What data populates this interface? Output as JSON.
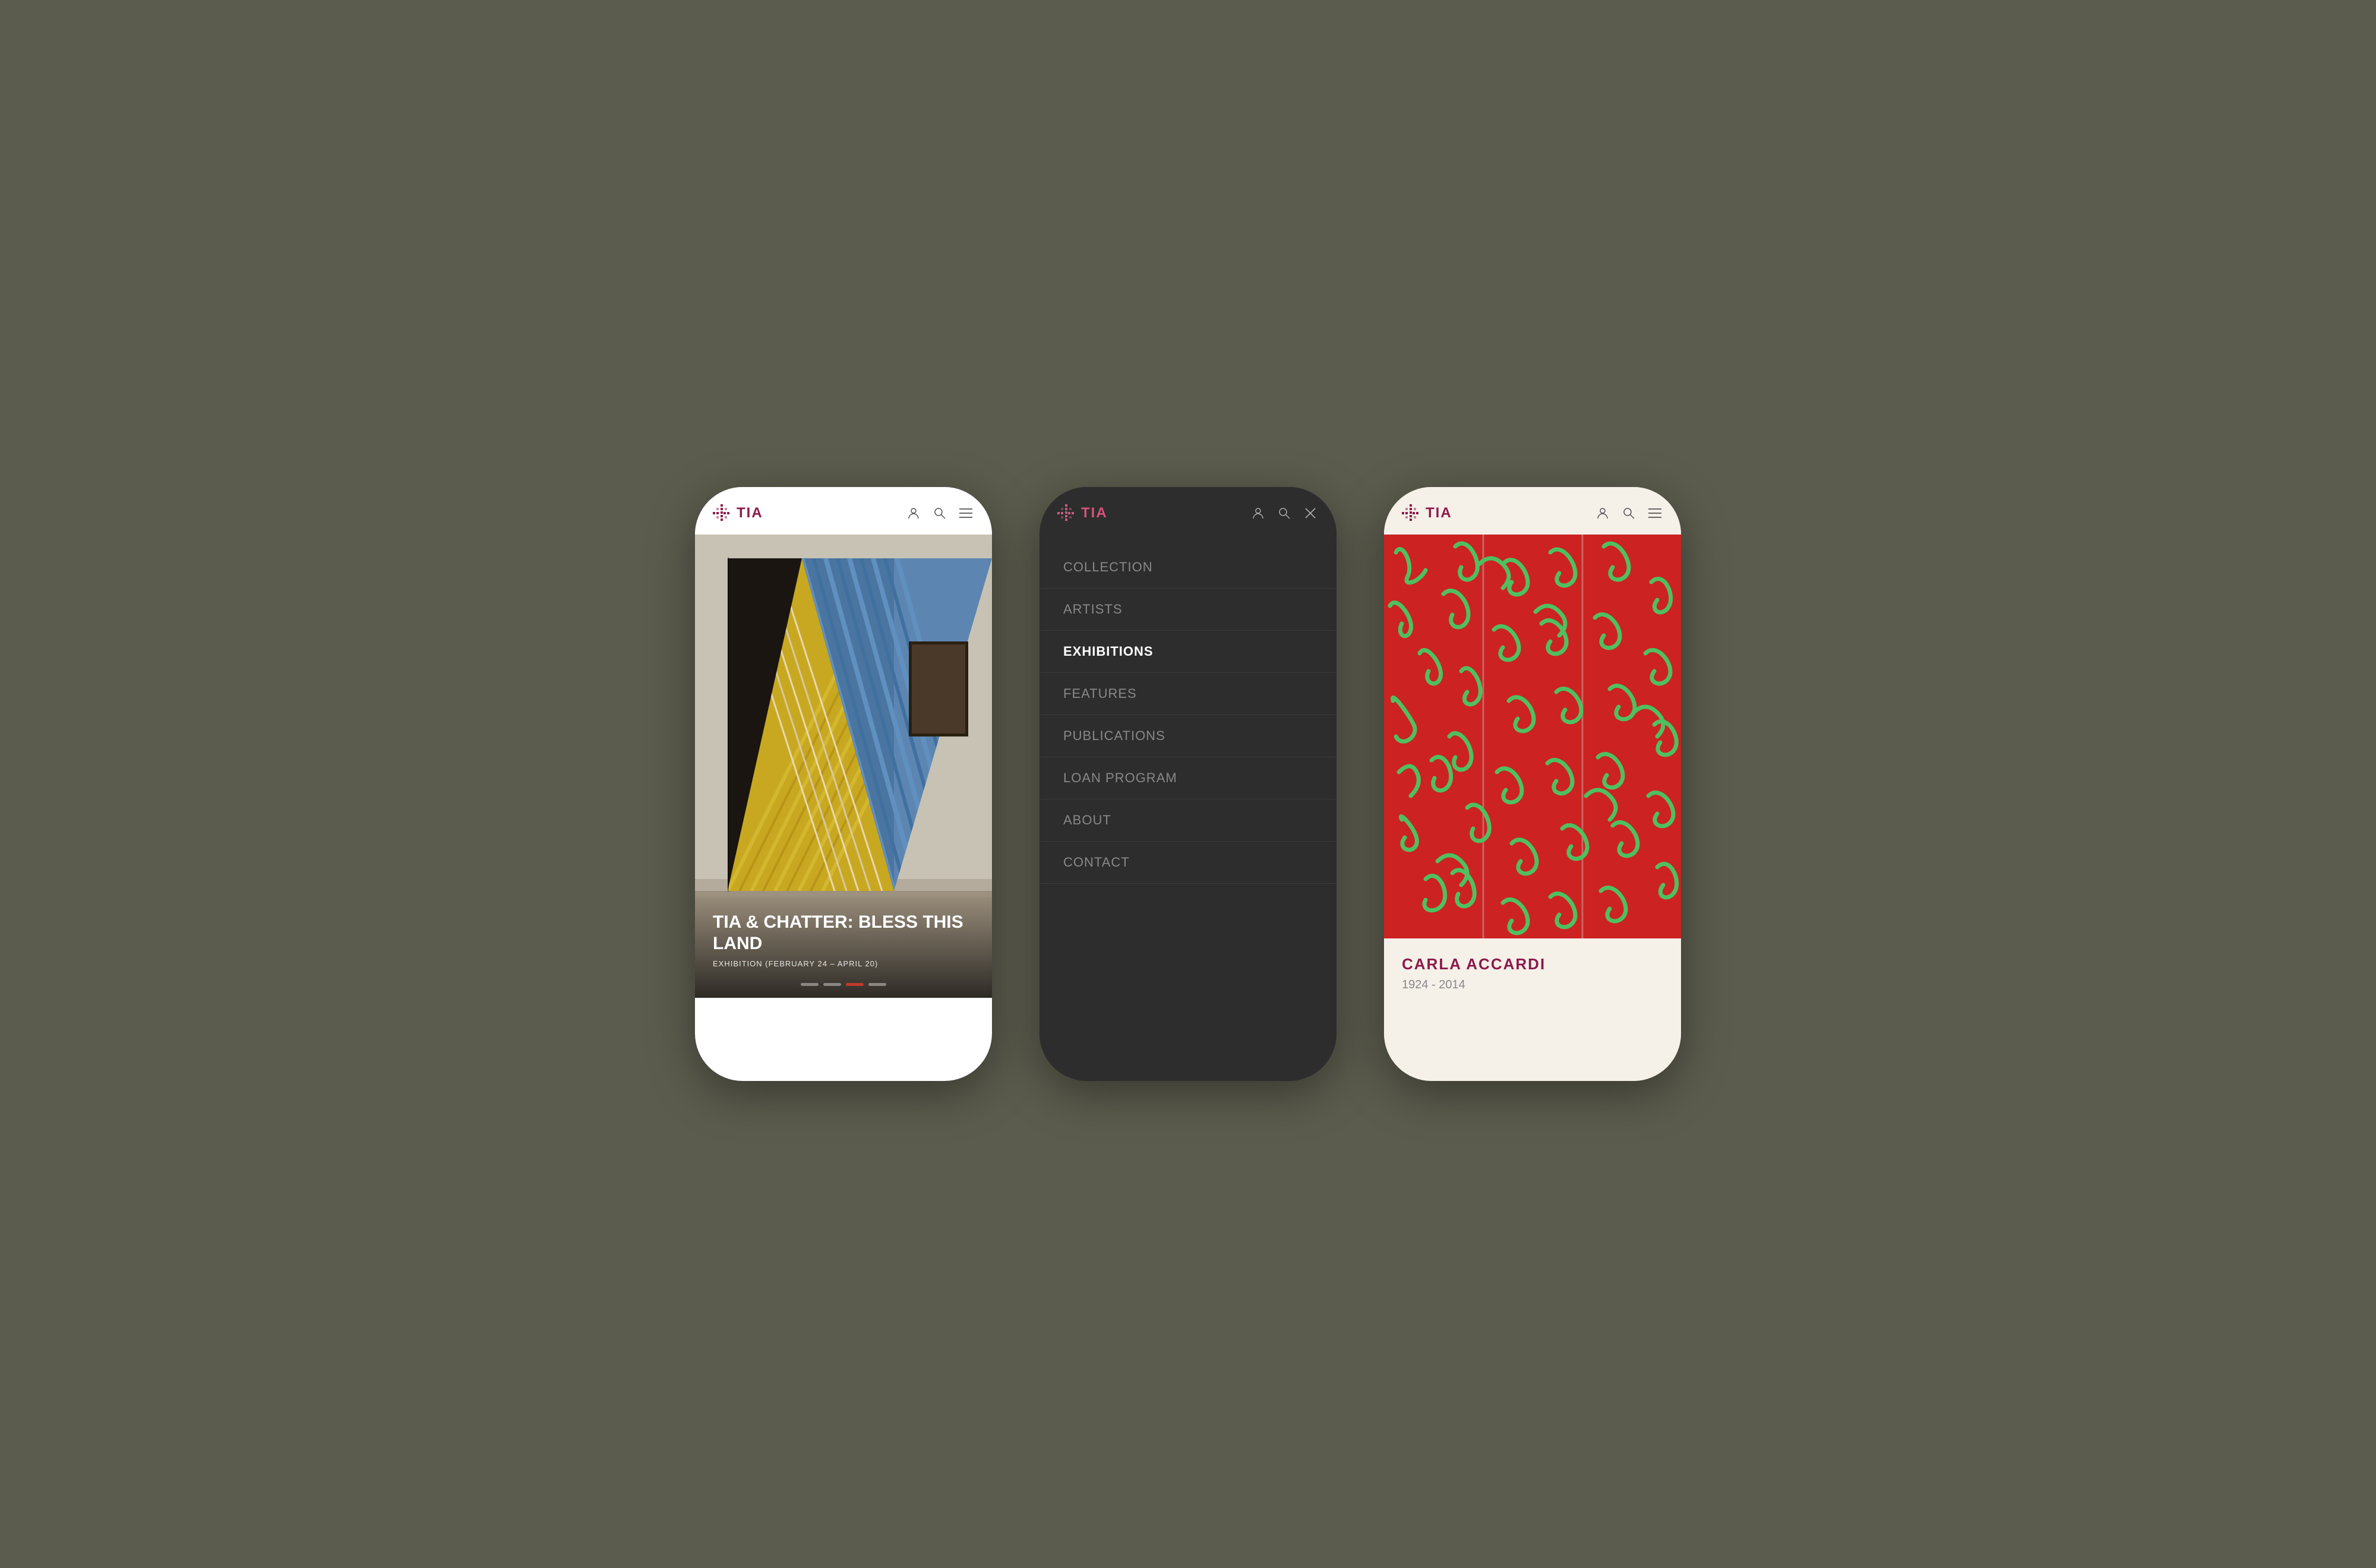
{
  "background": "#5c5c4e",
  "phones": {
    "left": {
      "logo": "TIA",
      "caption_title": "TIA & CHATTER:\nBLESS THIS LAND",
      "caption_sub": "EXHIBITION (FEBRUARY 24 – APRIL 20)",
      "dots": [
        "inactive",
        "inactive",
        "active",
        "inactive"
      ]
    },
    "middle": {
      "logo": "TIA",
      "menu_items": [
        {
          "label": "COLLECTION",
          "active": false
        },
        {
          "label": "ARTISTS",
          "active": false
        },
        {
          "label": "EXHIBITIONS",
          "active": true
        },
        {
          "label": "FEATURES",
          "active": false
        },
        {
          "label": "PUBLICATIONS",
          "active": false
        },
        {
          "label": "LOAN PROGRAM",
          "active": false
        },
        {
          "label": "ABOUT",
          "active": false
        },
        {
          "label": "CONTACT",
          "active": false
        }
      ]
    },
    "right": {
      "logo": "TIA",
      "artist_name": "CARLA ACCARDI",
      "artist_years": "1924 - 2014"
    }
  }
}
